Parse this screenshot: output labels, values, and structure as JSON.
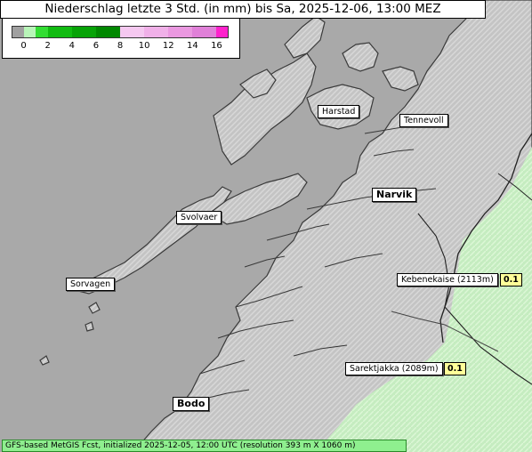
{
  "title": "Niederschlag letzte 3 Std. (in mm) bis Sa, 2025-12-06, 13:00 MEZ",
  "legend": {
    "ticks": [
      "0",
      "2",
      "4",
      "6",
      "8",
      "10",
      "12",
      "14",
      "16"
    ],
    "bands": [
      {
        "from": -1,
        "to": 0,
        "color": "#a0a0a0"
      },
      {
        "from": 0,
        "to": 1,
        "color": "#b8f5b8"
      },
      {
        "from": 1,
        "to": 2,
        "color": "#33dd33"
      },
      {
        "from": 2,
        "to": 4,
        "color": "#11bb11"
      },
      {
        "from": 4,
        "to": 6,
        "color": "#07a307"
      },
      {
        "from": 6,
        "to": 8,
        "color": "#008800"
      },
      {
        "from": 8,
        "to": 10,
        "color": "#f5c8f0"
      },
      {
        "from": 10,
        "to": 12,
        "color": "#f0b0e8"
      },
      {
        "from": 12,
        "to": 14,
        "color": "#ea98e0"
      },
      {
        "from": 14,
        "to": 16,
        "color": "#e080d8"
      },
      {
        "from": 16,
        "to": 17,
        "color": "#ff22cc"
      }
    ]
  },
  "places": [
    {
      "name": "Harstad",
      "key": "harstad"
    },
    {
      "name": "Tennevoll",
      "key": "tennevoll"
    },
    {
      "name": "Narvik",
      "key": "narvik"
    },
    {
      "name": "Svolvaer",
      "key": "svolvaer"
    },
    {
      "name": "Sorvagen",
      "key": "sorvagen"
    },
    {
      "name": "Kebenekaise (2113m)",
      "key": "kebenekaise",
      "value": "0.1"
    },
    {
      "name": "Sarektjakka (2089m)",
      "key": "sarektjakka",
      "value": "0.1"
    },
    {
      "name": "Bodo",
      "key": "bodo"
    }
  ],
  "footer": "GFS-based MetGIS Fcst, initialized 2025-12-05, 12:00 UTC  (resolution 393 m X 1060 m)",
  "colors": {
    "sea": "#a9a9a9",
    "land": "#c8c8c8",
    "light_precip": "#c8f0c0",
    "coast": "#3a3a3a",
    "border": "#222222"
  }
}
